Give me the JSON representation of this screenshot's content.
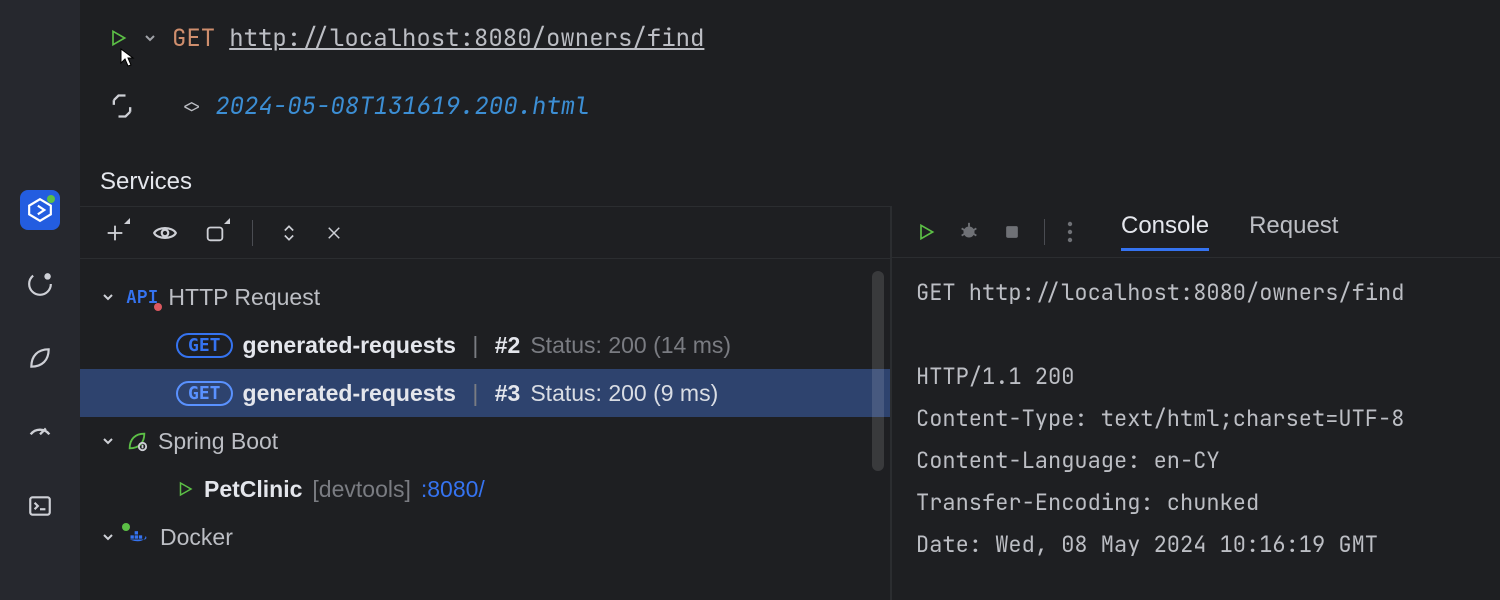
{
  "editor": {
    "method": "GET",
    "url": "http://localhost:8080/owners/find",
    "response_file": "2024-05-08T131619.200.html"
  },
  "services_label": "Services",
  "tree": {
    "http_request": "HTTP Request",
    "req1": {
      "method": "GET",
      "name": "generated-requests",
      "num": "#2",
      "status": "Status: 200 (14 ms)"
    },
    "req2": {
      "method": "GET",
      "name": "generated-requests",
      "num": "#3",
      "status": "Status: 200 (9 ms)"
    },
    "spring": "Spring Boot",
    "app": {
      "name": "PetClinic",
      "profile": "[devtools]",
      "port": ":8080/"
    },
    "docker": "Docker"
  },
  "right": {
    "tab_console": "Console",
    "tab_request": "Request",
    "lines": [
      "GET http://localhost:8080/owners/find",
      "",
      "HTTP/1.1 200 ",
      "Content-Type: text/html;charset=UTF-8",
      "Content-Language: en-CY",
      "Transfer-Encoding: chunked",
      "Date: Wed, 08 May 2024 10:16:19 GMT"
    ]
  }
}
